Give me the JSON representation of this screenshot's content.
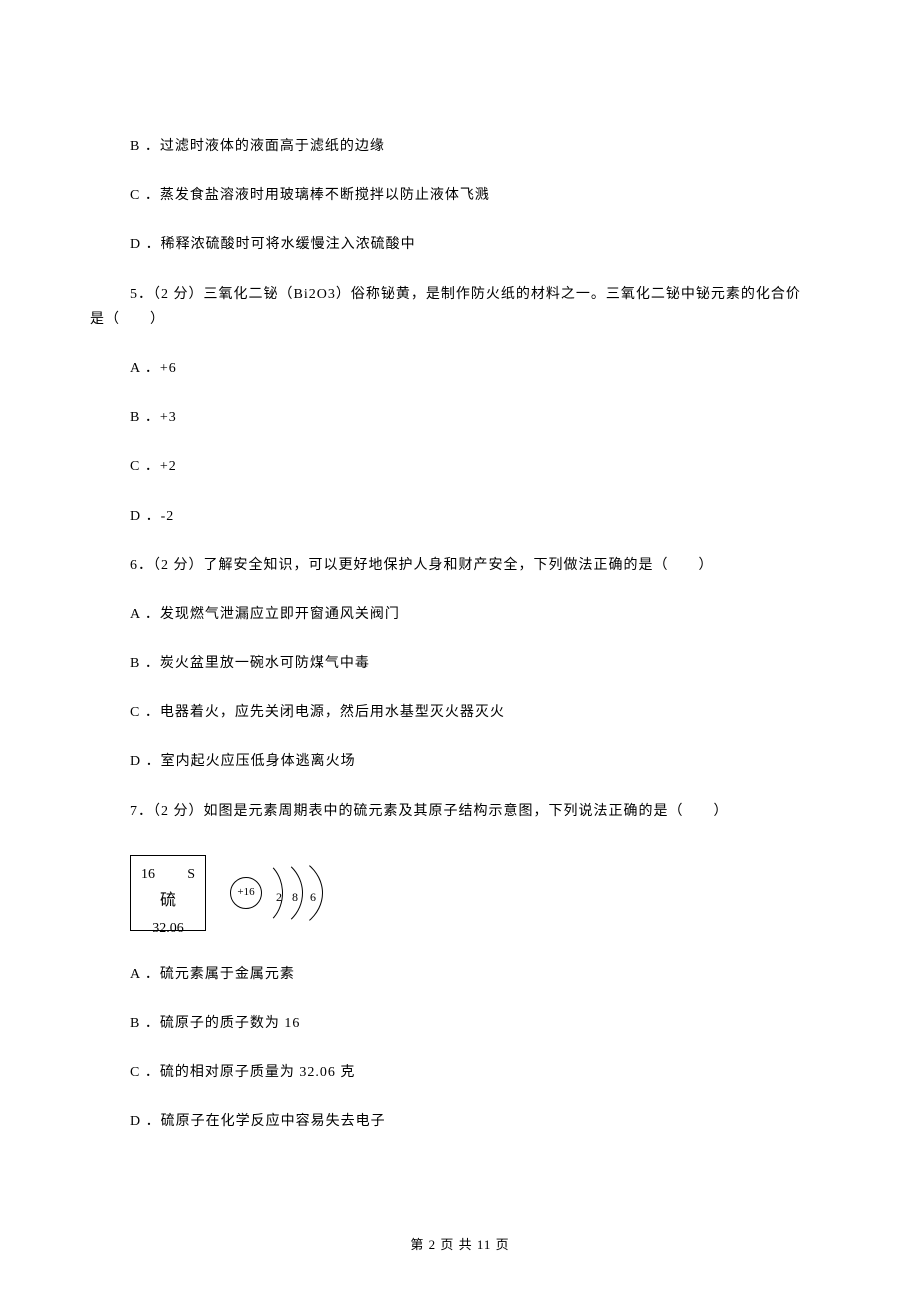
{
  "q4": {
    "optB": "B ．过滤时液体的液面高于滤纸的边缘",
    "optC": "C ．蒸发食盐溶液时用玻璃棒不断搅拌以防止液体飞溅",
    "optD": "D ．稀释浓硫酸时可将水缓慢注入浓硫酸中"
  },
  "q5": {
    "stem_line1": "5．（2 分）三氧化二铋（Bi2O3）俗称铋黄，是制作防火纸的材料之一。三氧化二铋中铋元素的化合价",
    "stem_line2": "是（　　）",
    "optA": "A ．+6",
    "optB": "B ．+3",
    "optC": "C ．+2",
    "optD": "D ．-2"
  },
  "q6": {
    "stem": "6．（2 分）了解安全知识，可以更好地保护人身和财产安全，下列做法正确的是（　　）",
    "optA": "A ．发现燃气泄漏应立即开窗通风关阀门",
    "optB": "B ．炭火盆里放一碗水可防煤气中毒",
    "optC": "C ．电器着火，应先关闭电源，然后用水基型灭火器灭火",
    "optD": "D ．室内起火应压低身体逃离火场"
  },
  "q7": {
    "stem": "7．（2 分）如图是元素周期表中的硫元素及其原子结构示意图，下列说法正确的是（　　）",
    "optA": "A ．硫元素属于金属元素",
    "optB": "B ．硫原子的质子数为 16",
    "optC": "C ．硫的相对原子质量为 32.06 克",
    "optD": "D ．硫原子在化学反应中容易失去电子"
  },
  "periodic": {
    "number": "16",
    "symbol": "S",
    "name": "硫",
    "mass": "32.06"
  },
  "atom": {
    "nucleus": "+16",
    "shell1": "2",
    "shell2": "8",
    "shell3": "6"
  },
  "footer": "第 2 页 共 11 页"
}
